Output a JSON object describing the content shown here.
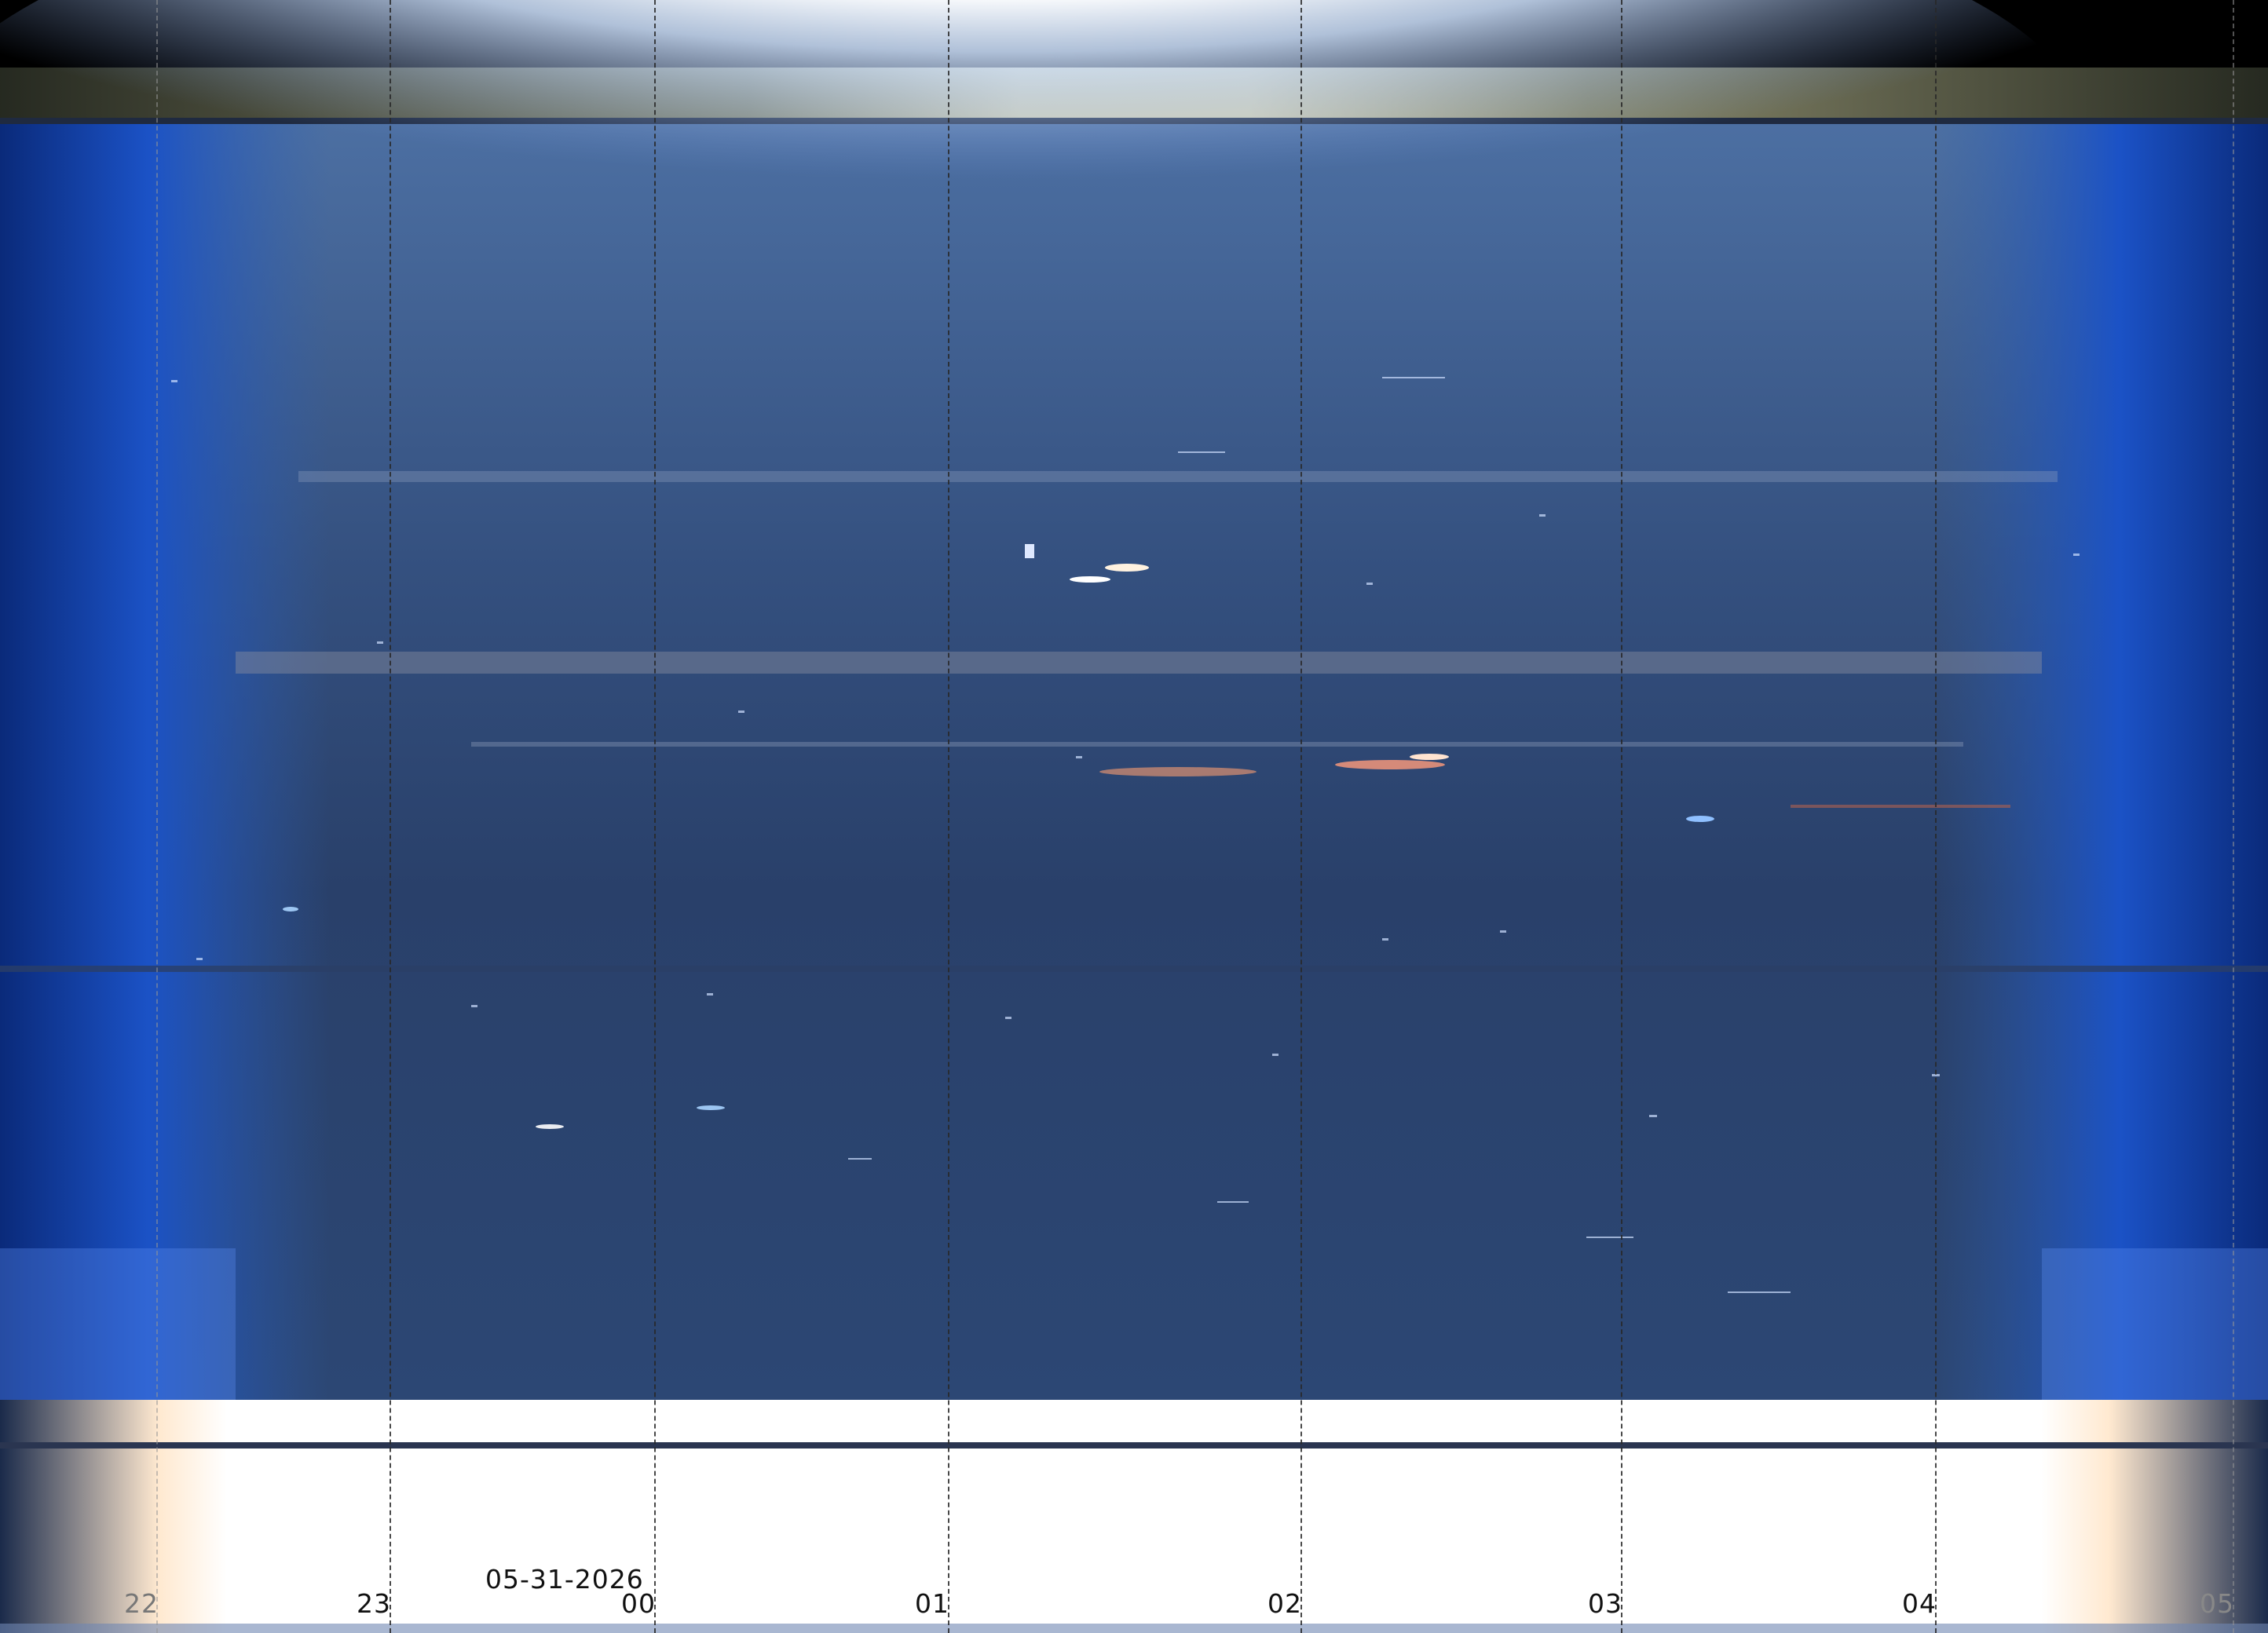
{
  "keogram": {
    "date_label": "05-31-2026",
    "hour_labels": [
      "22",
      "23",
      "00",
      "01",
      "02",
      "03",
      "04",
      "05"
    ]
  }
}
